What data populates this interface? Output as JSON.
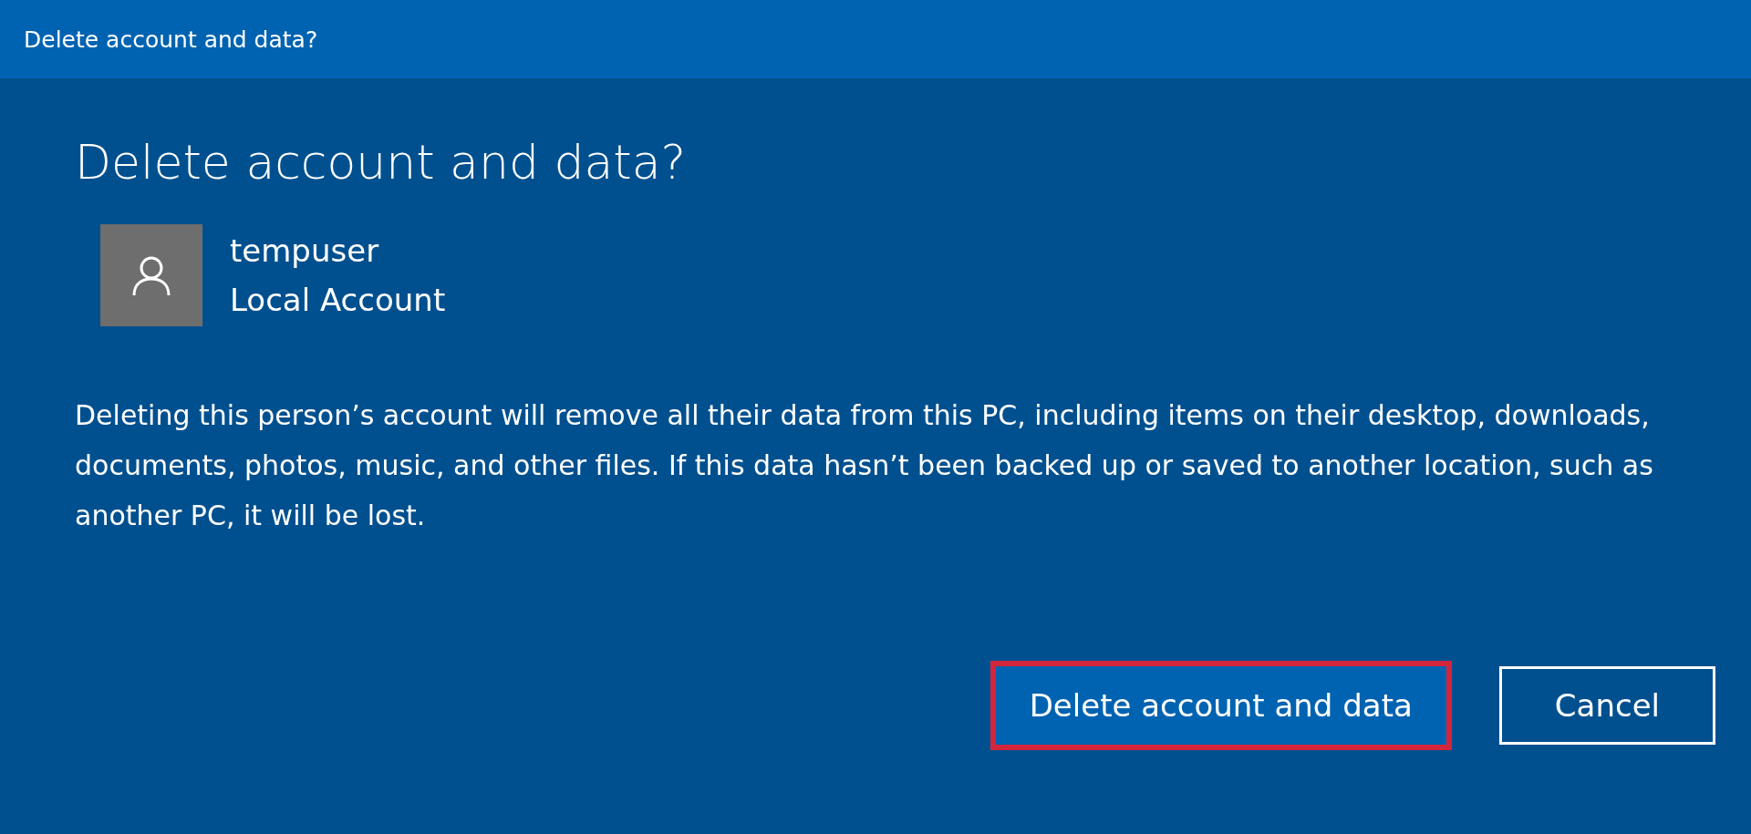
{
  "window": {
    "title": "Delete account and data?"
  },
  "heading": "Delete account and data?",
  "account": {
    "name": "tempuser",
    "type": "Local Account"
  },
  "message": "Deleting this person’s account will remove all their data from this PC, including items on their desktop, downloads, documents, photos, music, and other files. If this data hasn’t been backed up or saved to another location, such as another PC, it will be lost.",
  "buttons": [
    {
      "label": "Delete account and data",
      "kind": "primary",
      "highlighted": true
    },
    {
      "label": "Cancel",
      "kind": "secondary",
      "highlighted": false
    }
  ]
}
